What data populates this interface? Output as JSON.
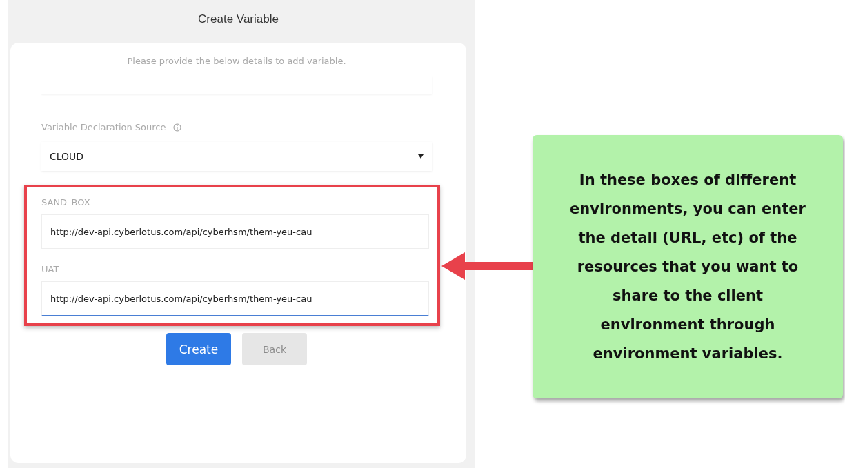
{
  "dialog": {
    "title": "Create Variable",
    "instructions": "Please provide the below details to add variable.",
    "source": {
      "label": "Variable Declaration Source",
      "value": "CLOUD"
    },
    "environments": [
      {
        "label": "SAND_BOX",
        "value": "http://dev-api.cyberlotus.com/api/cyberhsm/them-yeu-cau",
        "focused": false
      },
      {
        "label": "UAT",
        "value": "http://dev-api.cyberlotus.com/api/cyberhsm/them-yeu-cau",
        "focused": true
      }
    ],
    "buttons": [
      {
        "label": "Create",
        "disabled": false
      },
      {
        "label": "Back",
        "disabled": true
      }
    ]
  },
  "callout": {
    "text": "In these boxes of different environments, you can enter the detail (URL, etc) of the resources that you want to share to the client environment through environment variables."
  }
}
